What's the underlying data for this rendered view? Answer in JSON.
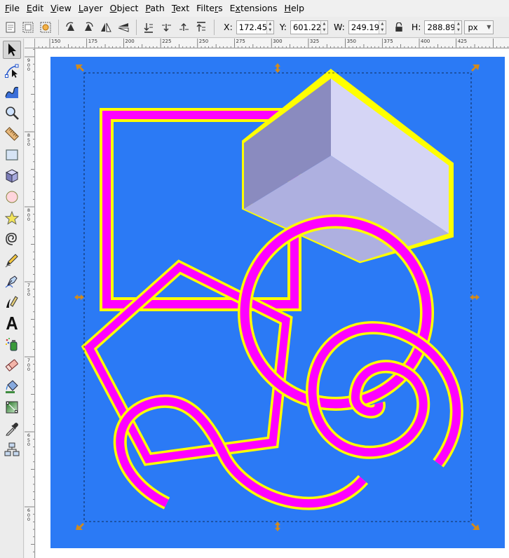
{
  "menu": [
    "File",
    "Edit",
    "View",
    "Layer",
    "Object",
    "Path",
    "Text",
    "Filters",
    "Extensions",
    "Help"
  ],
  "menu_mnemonics": [
    "F",
    "E",
    "V",
    "L",
    "O",
    "P",
    "T",
    "r",
    "x",
    "H"
  ],
  "selector_controls": {
    "x_label": "X:",
    "x_value": "172.458",
    "y_label": "Y:",
    "y_value": "601.224",
    "w_label": "W:",
    "w_value": "249.199",
    "h_label": "H:",
    "h_value": "288.891",
    "unit": "px"
  },
  "ruler": {
    "horizontal_labels": [
      "150",
      "175",
      "200",
      "225",
      "250",
      "275",
      "300",
      "325",
      "350",
      "375",
      "400",
      "425"
    ],
    "vertical_labels": [
      "900",
      "850",
      "800",
      "750",
      "700",
      "650",
      "600"
    ]
  },
  "tools": [
    "selector-tool",
    "node-tool",
    "tweak-tool",
    "zoom-tool",
    "measure-tool",
    "rectangle-tool",
    "3d-box-tool",
    "ellipse-tool",
    "star-tool",
    "spiral-tool",
    "pencil-tool",
    "pen-tool",
    "calligraphy-tool",
    "text-tool",
    "spray-tool",
    "eraser-tool",
    "paint-bucket-tool",
    "gradient-tool",
    "dropper-tool",
    "connector-tool"
  ],
  "active_tool": "selector-tool",
  "colors": {
    "page_background": "#2b7af5",
    "stroke_primary": "#ff00ff",
    "stroke_outline": "#ffff00",
    "box_top": "#d5d5f5",
    "box_left": "#8a8bbf",
    "box_front": "#aeb0e0",
    "selection_handles": "#d28a1c"
  }
}
